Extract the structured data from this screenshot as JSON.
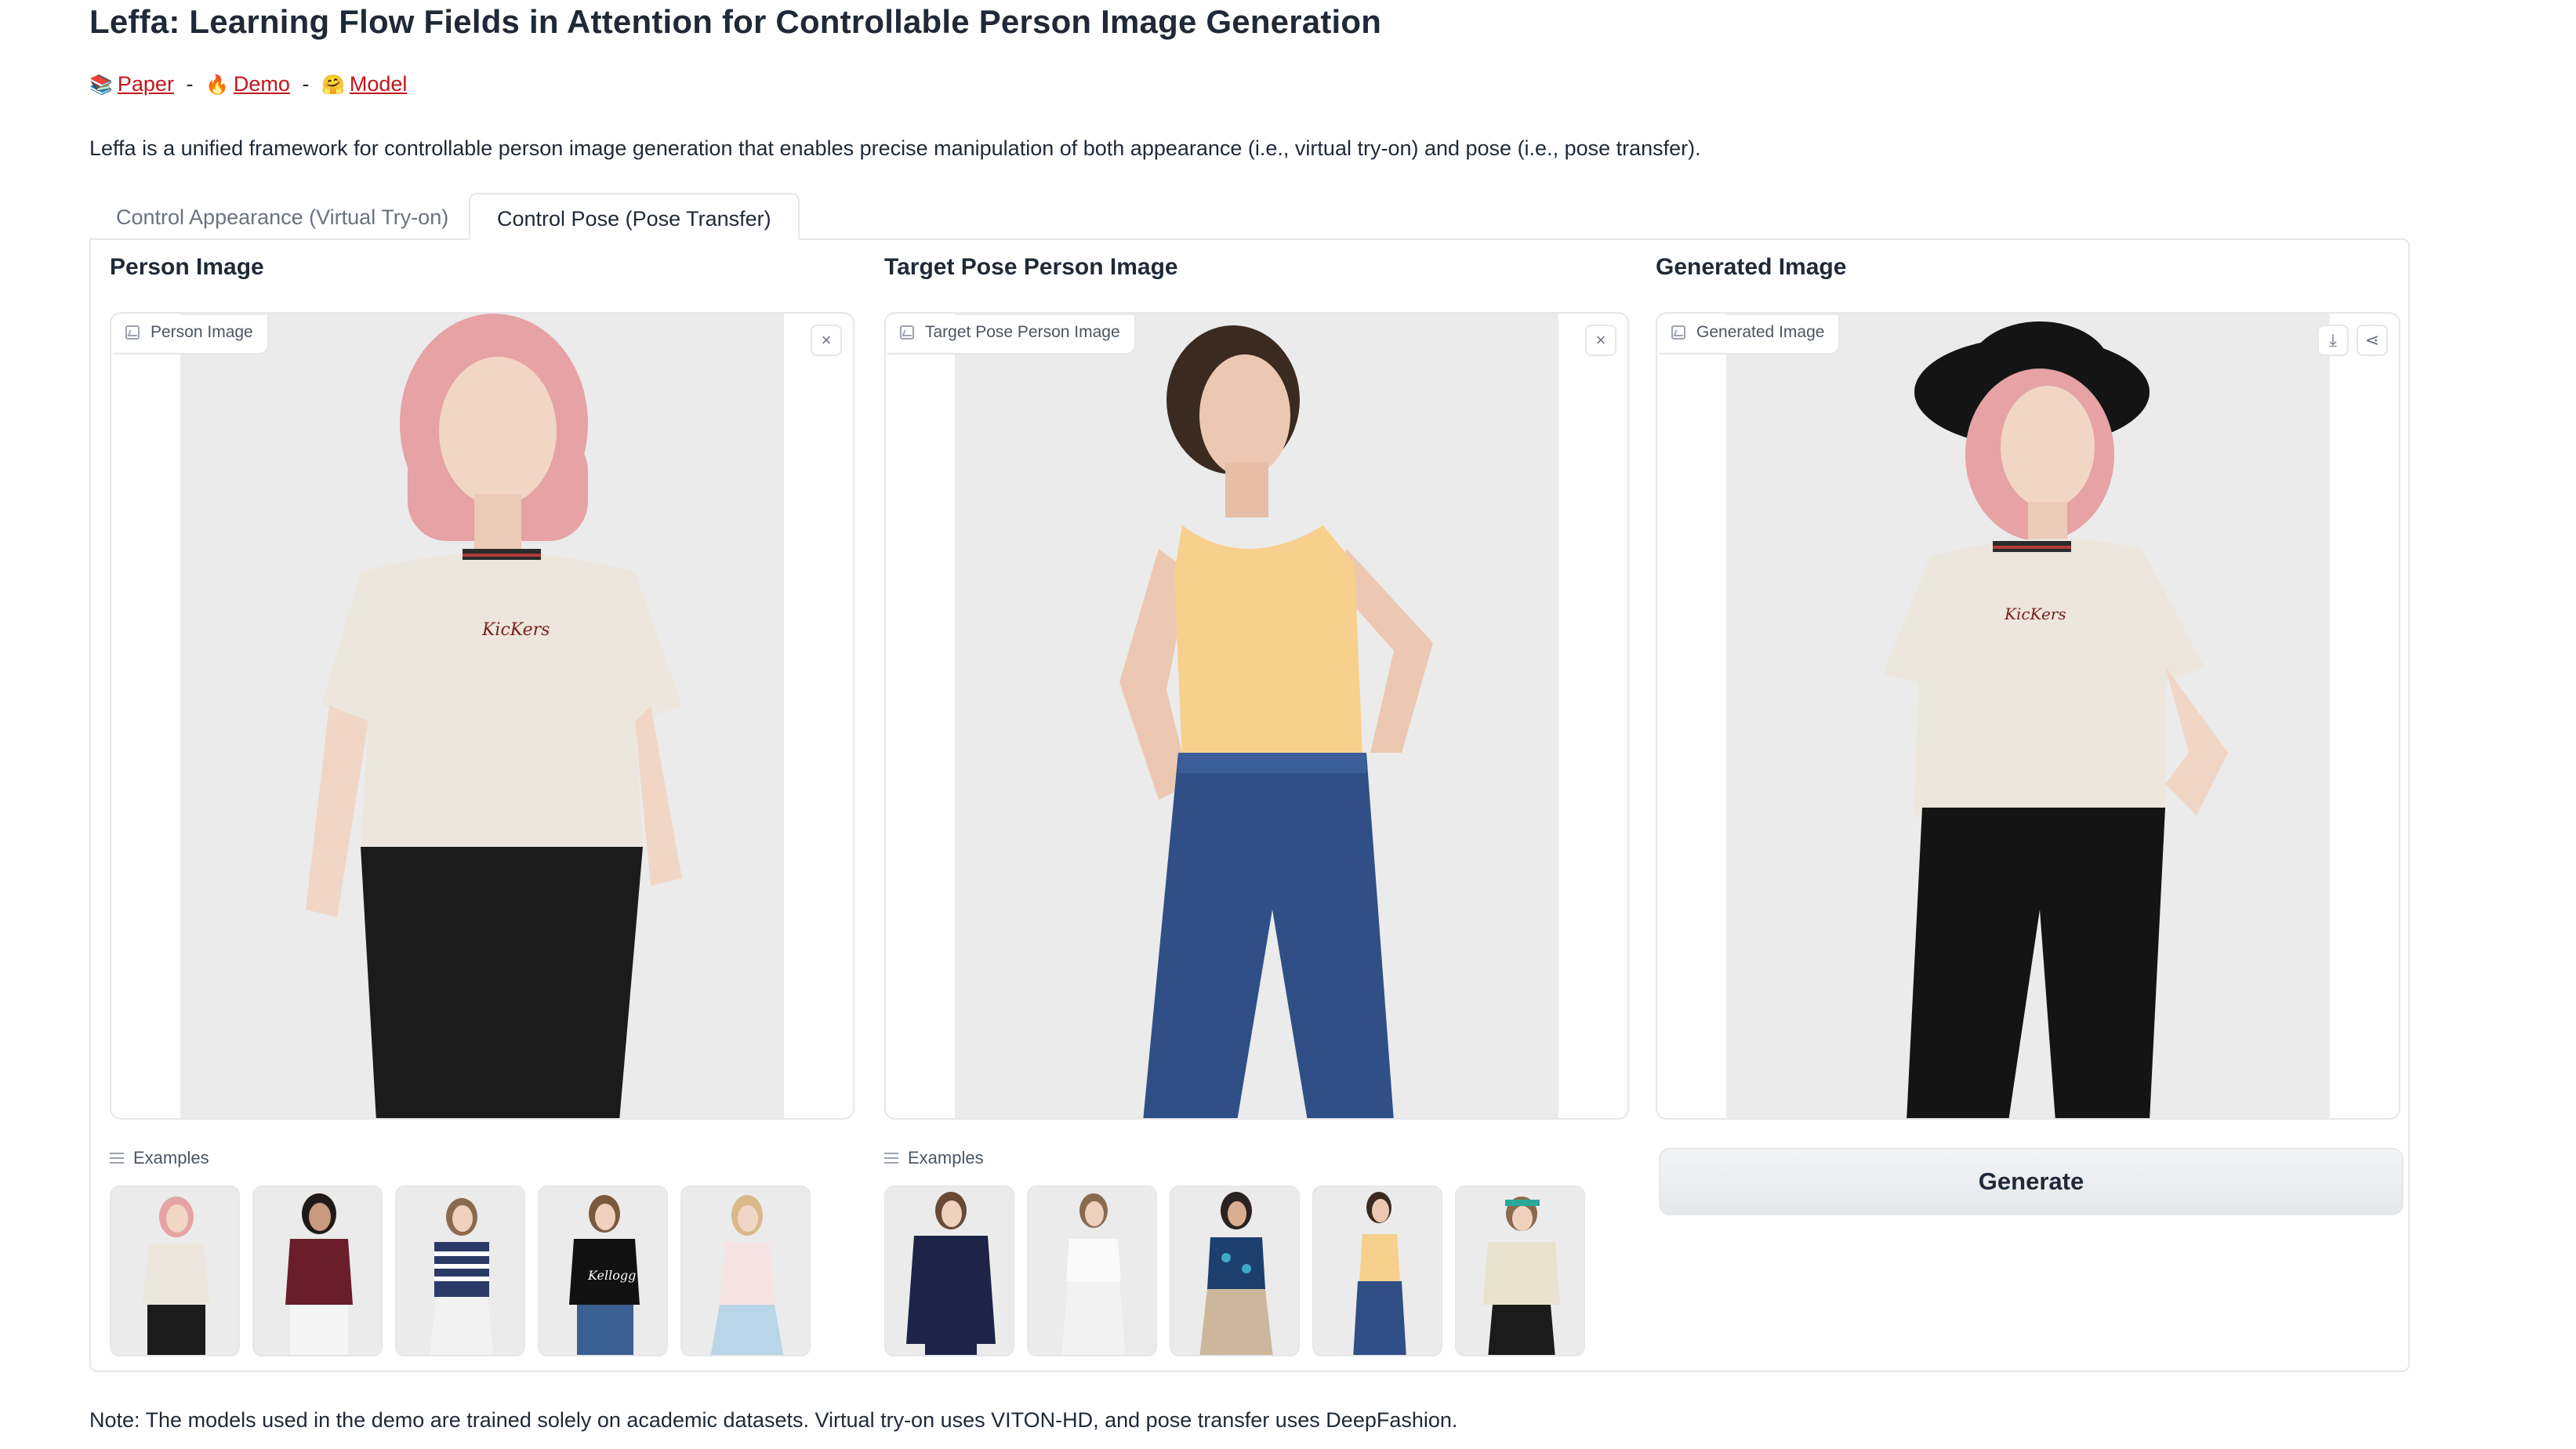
{
  "header": {
    "title": "Leffa: Learning Flow Fields in Attention for Controllable Person Image Generation",
    "links": [
      {
        "icon": "📚",
        "label": "Paper"
      },
      {
        "icon": "🔥",
        "label": "Demo"
      },
      {
        "icon": "🤗",
        "label": "Model"
      }
    ],
    "separator": "-",
    "description": "Leffa is a unified framework for controllable person image generation that enables precise manipulation of both appearance (i.e., virtual try-on) and pose (i.e., pose transfer)."
  },
  "tabs": [
    {
      "label": "Control Appearance (Virtual Try-on)",
      "active": false
    },
    {
      "label": "Control Pose (Pose Transfer)",
      "active": true
    }
  ],
  "columns": {
    "person": {
      "heading": "Person Image",
      "badge": "Person Image",
      "examples_label": "Examples"
    },
    "target": {
      "heading": "Target Pose Person Image",
      "badge": "Target Pose Person Image",
      "examples_label": "Examples"
    },
    "generated": {
      "heading": "Generated Image",
      "badge": "Generated Image"
    }
  },
  "icons": {
    "close": "×",
    "download": "⤓",
    "share": "⋖"
  },
  "generate_button": "Generate",
  "note": "Note: The models used in the demo are trained solely on academic datasets. Virtual try-on uses VITON-HD, and pose transfer uses DeepFashion.",
  "colors": {
    "link": "#c2161b",
    "border": "#e5e7eb",
    "photo_bg": "#e8e8e8"
  }
}
